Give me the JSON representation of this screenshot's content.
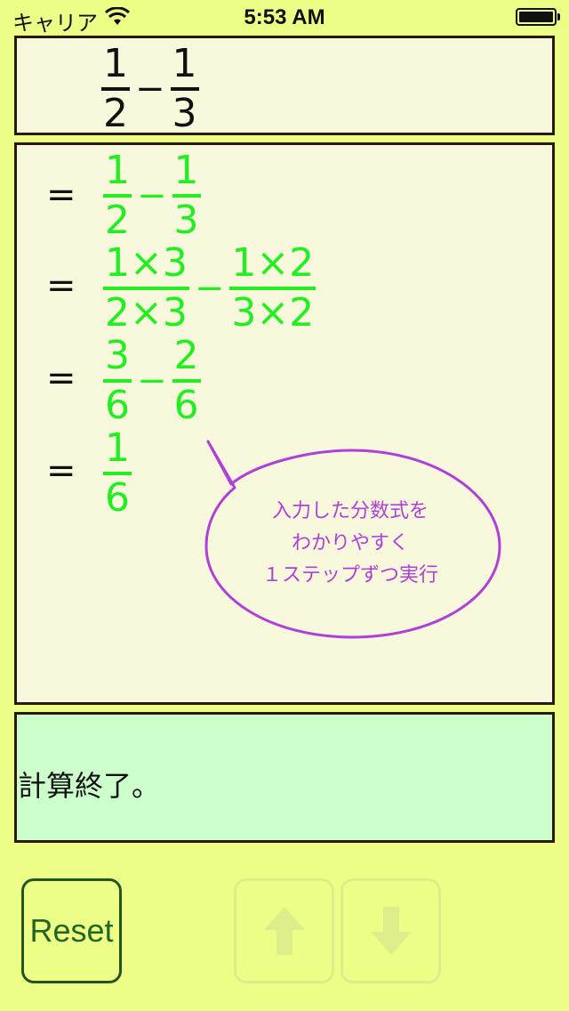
{
  "status_bar": {
    "carrier": "キャリア",
    "time": "5:53 AM"
  },
  "input_expression": {
    "a_num": "1",
    "a_den": "2",
    "op": "−",
    "b_num": "1",
    "b_den": "3"
  },
  "steps": [
    {
      "eq": "=",
      "a_num": "1",
      "a_den": "2",
      "op": "−",
      "b_num": "1",
      "b_den": "3"
    },
    {
      "eq": "=",
      "a_num": "1×3",
      "a_den": "2×3",
      "op": "−",
      "b_num": "1×2",
      "b_den": "3×2"
    },
    {
      "eq": "=",
      "a_num": "3",
      "a_den": "6",
      "op": "−",
      "b_num": "2",
      "b_den": "6"
    },
    {
      "eq": "=",
      "a_num": "1",
      "a_den": "6"
    }
  ],
  "bubble": {
    "lines": [
      "入力した分数式を",
      "わかりやすく",
      "１ステップずつ実行"
    ]
  },
  "message": "計算終了。",
  "buttons": {
    "reset_label": "Reset",
    "up_icon": "arrow-up-icon",
    "down_icon": "arrow-down-icon"
  },
  "colors": {
    "background": "#eeff88",
    "panel": "#f7f8dc",
    "message_panel": "#ccffcc",
    "step_text": "#22ee22",
    "bubble_text": "#b040d8"
  }
}
